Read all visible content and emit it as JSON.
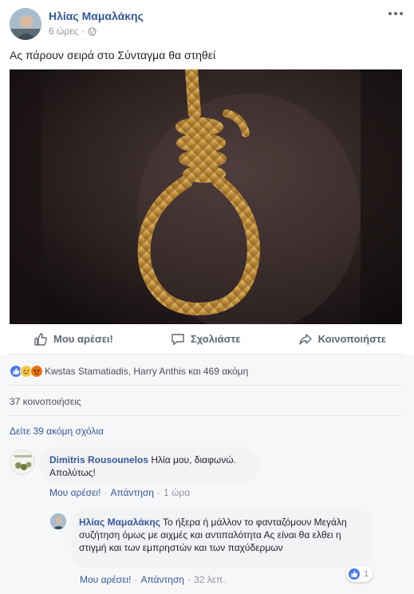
{
  "post": {
    "author": "Ηλίας Μαμαλάκης",
    "time": "6 ώρες",
    "privacy_icon": "globe-icon",
    "more_icon": "more-options-icon",
    "text": "Ας πάρουν σειρά στο Σύνταγμα θα στηθεί",
    "image_subject": "noose-rope-photo"
  },
  "actions": {
    "like": "Μου αρέσει!",
    "comment": "Σχολιάστε",
    "share": "Κοινοποιήστε"
  },
  "reactions": {
    "icons": [
      "like-reaction-icon",
      "sad-reaction-icon",
      "angry-reaction-icon"
    ],
    "summary": "Kwstas Stamatiadis, Harry Anthis και 469 ακόμη"
  },
  "shares_text": "37 κοινοποιήσεις",
  "more_comments": "Δείτε 39 ακόμη σχόλια",
  "comments": [
    {
      "author": "Dimitris Rousounelos",
      "text": "Ηλία μου, διαφωνώ. Απολύτως!",
      "like": "Μου αρέσει!",
      "reply": "Απάντηση",
      "time": "1 ώρα"
    },
    {
      "author": "Ηλίας Μαμαλάκης",
      "text": "Το ήξερα ή μάλλον το φανταζόμουν Μεγάλη συζήτηση όμως με αιχμές και αντιπαλότητα Ας είναι θα ελθει η στιγμή και των εμπρηστών και των παχύδερμων",
      "like": "Μου αρέσει!",
      "reply": "Απάντηση",
      "time": "32 λεπ.",
      "reaction_count": "1"
    }
  ],
  "separator": "·",
  "colors": {
    "link_blue": "#365899",
    "text": "#1d2129",
    "secondary": "#90949c",
    "action_gray": "#606770",
    "gray_bg": "#f6f7f9",
    "bubble_bg": "#f2f3f5",
    "like_blue": "#4a78e6",
    "angry_orange": "#e9710f",
    "sad_yellow": "#f7c843"
  }
}
